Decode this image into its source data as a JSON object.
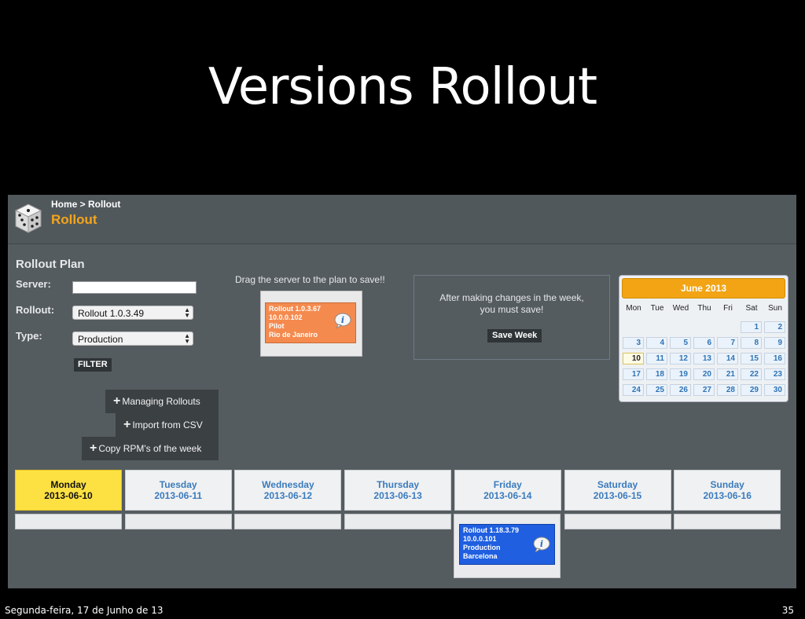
{
  "slide": {
    "title": "Versions Rollout",
    "footer_date": "Segunda-feira, 17 de Junho de 13",
    "page_number": "35"
  },
  "app": {
    "breadcrumb": "Home > Rollout",
    "page_title": "Rollout",
    "logo_icon": "dice-icon"
  },
  "rollout_plan": {
    "title": "Rollout Plan",
    "server_label": "Server:",
    "server_value": "",
    "rollout_label": "Rollout:",
    "rollout_value": "Rollout 1.0.3.49",
    "type_label": "Type:",
    "type_value": "Production",
    "filter_label": "FILTER"
  },
  "actions": {
    "managing": "Managing Rollouts",
    "import": "Import from CSV",
    "copy": "Copy RPM's of the week"
  },
  "drag_area": {
    "message": "Drag the server to the plan to save!!",
    "card": {
      "line1": "Rollout 1.0.3.67",
      "line2": "10.0.0.102",
      "line3": "Pilot",
      "line4": "Rio de Janeiro",
      "color": "#f58a4e"
    }
  },
  "save_panel": {
    "line1": "After making changes in the week,",
    "line2": "you must save!",
    "button": "Save Week"
  },
  "calendar": {
    "month": "June 2013",
    "dows": [
      "Mon",
      "Tue",
      "Wed",
      "Thu",
      "Fri",
      "Sat",
      "Sun"
    ],
    "weeks": [
      [
        "",
        "",
        "",
        "",
        "",
        "1",
        "2"
      ],
      [
        "3",
        "4",
        "5",
        "6",
        "7",
        "8",
        "9"
      ],
      [
        "10",
        "11",
        "12",
        "13",
        "14",
        "15",
        "16"
      ],
      [
        "17",
        "18",
        "19",
        "20",
        "21",
        "22",
        "23"
      ],
      [
        "24",
        "25",
        "26",
        "27",
        "28",
        "29",
        "30"
      ]
    ],
    "today": "10",
    "accent": "#f2a414"
  },
  "week": {
    "days": [
      {
        "name": "Monday",
        "date": "2013-06-10",
        "active": true
      },
      {
        "name": "Tuesday",
        "date": "2013-06-11",
        "active": false
      },
      {
        "name": "Wednesday",
        "date": "2013-06-12",
        "active": false
      },
      {
        "name": "Thursday",
        "date": "2013-06-13",
        "active": false
      },
      {
        "name": "Friday",
        "date": "2013-06-14",
        "active": false
      },
      {
        "name": "Saturday",
        "date": "2013-06-15",
        "active": false
      },
      {
        "name": "Sunday",
        "date": "2013-06-16",
        "active": false
      }
    ],
    "friday_card": {
      "line1": "Rollout 1.18.3.79",
      "line2": "10.0.0.101",
      "line3": "Production",
      "line4": "Barcelona",
      "color": "#1f5fe0"
    }
  }
}
